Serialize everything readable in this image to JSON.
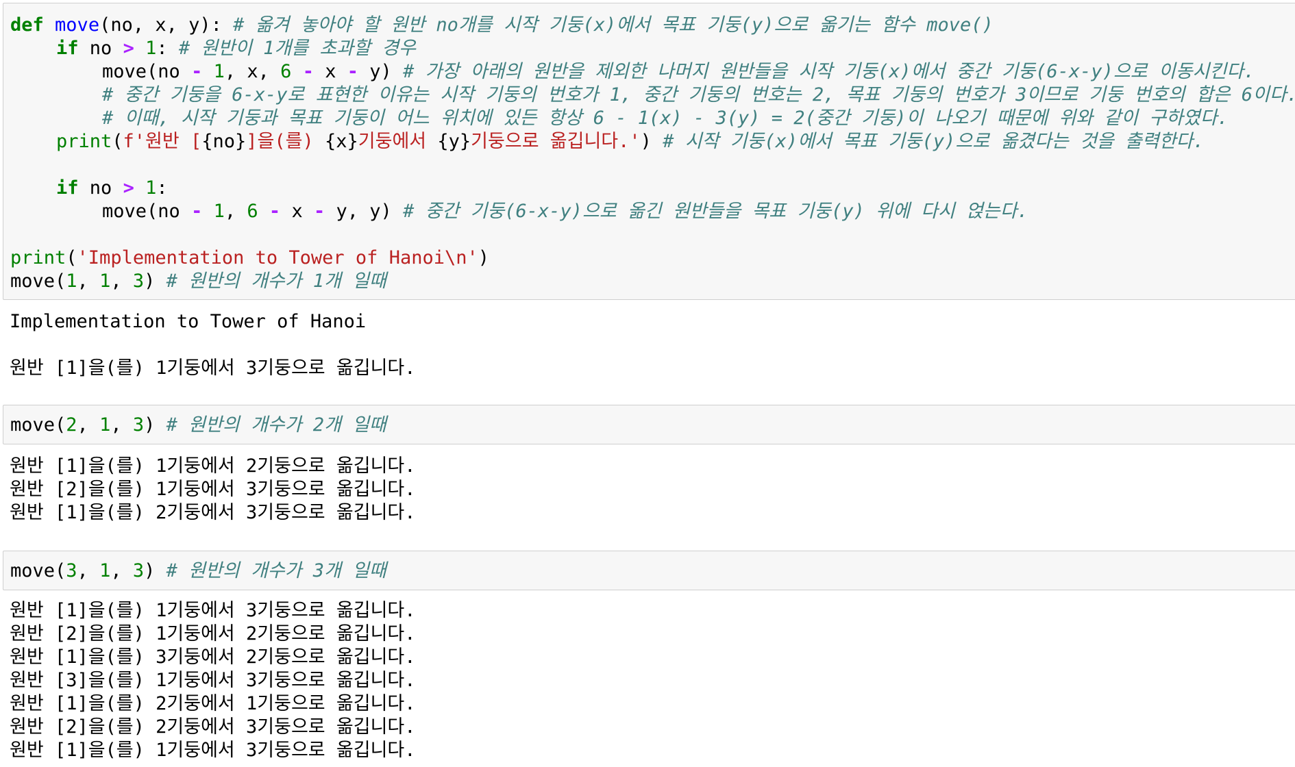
{
  "cell1": {
    "line1": {
      "kw_def": "def",
      "func": "move",
      "args": "(no, x, y):",
      "comment": "# 옮겨 놓아야 할 원반 no개를 시작 기둥(x)에서 목표 기둥(y)으로 옮기는 함수 move()"
    },
    "line2": {
      "kw_if": "if",
      "var": "no",
      "op": ">",
      "num": "1",
      "colon": ":",
      "comment": "# 원반이 1개를 초과할 경우"
    },
    "line3": {
      "call": "move(no",
      "op1": "-",
      "num1": "1",
      "mid1": ", x,",
      "num2": "6",
      "op2": "-",
      "mid2": "x",
      "op3": "-",
      "end": "y)",
      "comment": "# 가장 아래의 원반을 제외한 나머지 원반들을 시작 기둥(x)에서 중간 기둥(6-x-y)으로 이동시킨다."
    },
    "line4": {
      "comment": "# 중간 기둥을 6-x-y로 표현한 이유는 시작 기둥의 번호가 1, 중간 기둥의 번호는 2, 목표 기둥의 번호가 3이므로 기둥 번호의 합은 6이다."
    },
    "line5": {
      "comment": "# 이때, 시작 기둥과 목표 기둥이 어느 위치에 있든 항상 6 - 1(x) - 3(y) = 2(중간 기둥)이 나오기 때문에 위와 같이 구하였다."
    },
    "line6": {
      "builtin": "print",
      "paren": "(",
      "fstr": "f'원반 [",
      "var1": "{no}",
      "str2": "]을(를) ",
      "var2": "{x}",
      "str3": "기둥에서 ",
      "var3": "{y}",
      "str4": "기둥으로 옮깁니다.'",
      "close": ")",
      "comment": "# 시작 기둥(x)에서 목표 기둥(y)으로 옮겼다는 것을 출력한다."
    },
    "line7": {
      "kw_if": "if",
      "var": "no",
      "op": ">",
      "num": "1",
      "colon": ":"
    },
    "line8": {
      "call": "move(no",
      "op1": "-",
      "num1": "1",
      "mid1": ",",
      "num2": "6",
      "op2": "-",
      "mid2": "x",
      "op3": "-",
      "end": "y, y)",
      "comment": "# 중간 기둥(6-x-y)으로 옮긴 원반들을 목표 기둥(y) 위에 다시 얹는다."
    },
    "line9": {
      "builtin": "print",
      "open": "(",
      "str": "'Implementation to Tower of Hanoi\\n'",
      "close": ")"
    },
    "line10": {
      "call": "move(",
      "a1": "1",
      "sep1": ",",
      "a2": "1",
      "sep2": ",",
      "a3": "3",
      "close": ")",
      "comment": "# 원반의 개수가 1개 일때"
    }
  },
  "output1": [
    "Implementation to Tower of Hanoi",
    "",
    "원반 [1]을(를) 1기둥에서 3기둥으로 옮깁니다."
  ],
  "cell2": {
    "call": "move(",
    "a1": "2",
    "sep1": ",",
    "a2": "1",
    "sep2": ",",
    "a3": "3",
    "close": ")",
    "comment": "# 원반의 개수가 2개 일때"
  },
  "output2": [
    "원반 [1]을(를) 1기둥에서 2기둥으로 옮깁니다.",
    "원반 [2]을(를) 1기둥에서 3기둥으로 옮깁니다.",
    "원반 [1]을(를) 2기둥에서 3기둥으로 옮깁니다."
  ],
  "cell3": {
    "call": "move(",
    "a1": "3",
    "sep1": ",",
    "a2": "1",
    "sep2": ",",
    "a3": "3",
    "close": ")",
    "comment": "# 원반의 개수가 3개 일때"
  },
  "output3": [
    "원반 [1]을(를) 1기둥에서 3기둥으로 옮깁니다.",
    "원반 [2]을(를) 1기둥에서 2기둥으로 옮깁니다.",
    "원반 [1]을(를) 3기둥에서 2기둥으로 옮깁니다.",
    "원반 [3]을(를) 1기둥에서 3기둥으로 옮깁니다.",
    "원반 [1]을(를) 2기둥에서 1기둥으로 옮깁니다.",
    "원반 [2]을(를) 2기둥에서 3기둥으로 옮깁니다.",
    "원반 [1]을(를) 1기둥에서 3기둥으로 옮깁니다."
  ],
  "colors": {
    "keyword": "#008000",
    "function": "#0000ff",
    "operator": "#aa22ff",
    "string": "#ba2121",
    "comment": "#408080",
    "cell_background": "#f7f7f7",
    "cell_border": "#cfcfcf"
  }
}
